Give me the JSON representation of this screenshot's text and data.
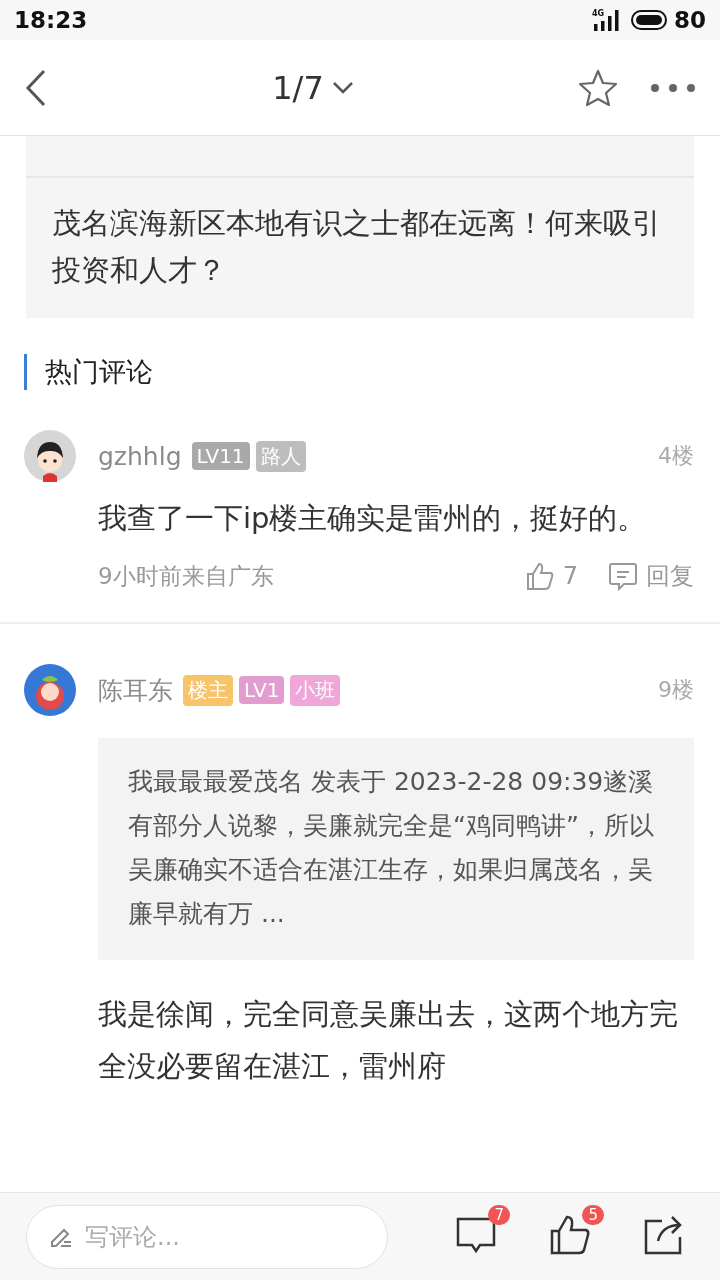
{
  "status_bar": {
    "time": "18:23",
    "network": "4G",
    "battery": "80"
  },
  "header": {
    "page": "1/7"
  },
  "post_card": {
    "title": "茂名滨海新区本地有识之士都在远离！何来吸引投资和人才？"
  },
  "section": {
    "title": "热门评论"
  },
  "comments": [
    {
      "avatar": {
        "kind": "boy"
      },
      "user": "gzhhlg",
      "tags": [
        {
          "label": "LV11",
          "color": "#a9a9a9"
        },
        {
          "label": "路人",
          "color": "#bdbdbd"
        }
      ],
      "floor": "4楼",
      "text": "我查了一下ip楼主确实是雷州的，挺好的。",
      "meta": "9小时前来自广东",
      "likes": "7",
      "reply": "回复"
    },
    {
      "avatar": {
        "kind": "fruit"
      },
      "user": "陈耳东",
      "tags": [
        {
          "label": "楼主",
          "color": "#f8c46a"
        },
        {
          "label": "LV1",
          "color": "#e39ccf"
        },
        {
          "label": "小班",
          "color": "#f0a6d8"
        }
      ],
      "floor": "9楼",
      "quote": "我最最最爱茂名 发表于 2023-2-28 09:39遂溪有部分人说黎，吴廉就完全是“鸡同鸭讲”，所以吴廉确实不适合在湛江生存，如果归属茂名，吴廉早就有万 ...",
      "text": "我是徐闻，完全同意吴廉出去，这两个地方完全没必要留在湛江，雷州府"
    }
  ],
  "bottom_bar": {
    "placeholder": "写评论...",
    "comment_count": "7",
    "like_count": "5"
  }
}
